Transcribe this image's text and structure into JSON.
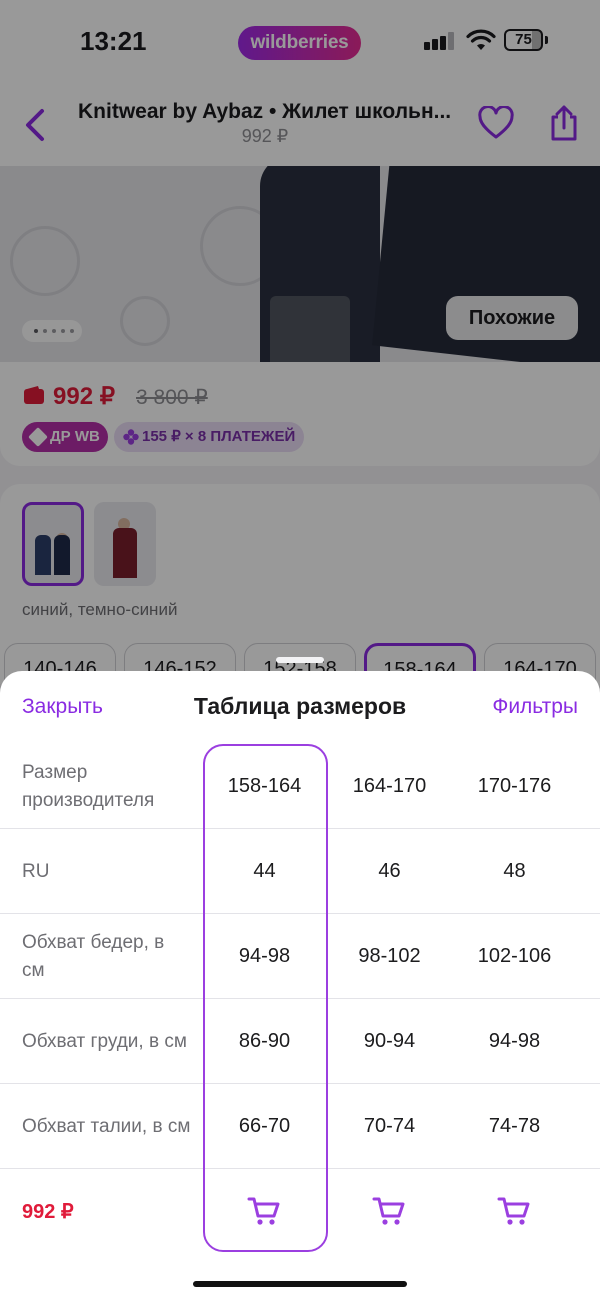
{
  "status_bar": {
    "time": "13:21",
    "brand": "wildberries",
    "battery": "75",
    "icons": [
      "signal-icon",
      "wifi-icon",
      "battery-icon"
    ]
  },
  "nav": {
    "title": "Knitwear by Aybaz • Жилет школьн...",
    "subtitle": "992 ₽",
    "icons": [
      "back-chevron-icon",
      "heart-icon",
      "share-icon"
    ]
  },
  "hero": {
    "similar_label": "Похожие"
  },
  "price": {
    "current": "992 ₽",
    "old": "3 800 ₽",
    "badge_dr": "ДР WB",
    "badge_split": "155 ₽ × 8 ПЛАТЕЖЕЙ"
  },
  "variants": {
    "color_name": "синий, темно-синий",
    "size_chips": [
      "140-146",
      "146-152",
      "152-158",
      "158-164",
      "164-170"
    ],
    "selected_chip": "158-164"
  },
  "sheet": {
    "close_label": "Закрыть",
    "title": "Таблица размеров",
    "filters_label": "Фильтры",
    "rows": [
      {
        "label": "Размер производителя",
        "values": [
          "158-164",
          "164-170",
          "170-176"
        ]
      },
      {
        "label": "RU",
        "values": [
          "44",
          "46",
          "48"
        ]
      },
      {
        "label": "Обхват бедер, в см",
        "values": [
          "94-98",
          "98-102",
          "102-106"
        ]
      },
      {
        "label": "Обхват груди, в см",
        "values": [
          "86-90",
          "90-94",
          "94-98"
        ]
      },
      {
        "label": "Обхват талии, в см",
        "values": [
          "66-70",
          "70-74",
          "74-78"
        ]
      }
    ],
    "price": "992 ₽",
    "selected_column": "158-164"
  },
  "colors": {
    "accent": "#8a2be2",
    "price_red": "#e01b3a",
    "brand_gradient_start": "#a02be8",
    "brand_gradient_end": "#e72c93"
  }
}
